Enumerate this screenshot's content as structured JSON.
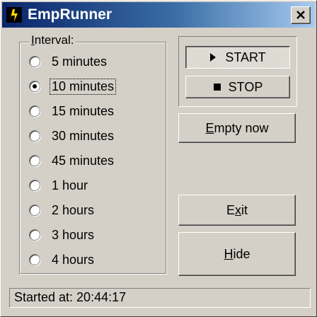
{
  "window": {
    "title": "EmpRunner"
  },
  "interval": {
    "legend": "Interval:",
    "options": [
      "5 minutes",
      "10 minutes",
      "15 minutes",
      "30 minutes",
      "45 minutes",
      "1 hour",
      "2 hours",
      "3 hours",
      "4 hours"
    ],
    "selected": "10 minutes"
  },
  "buttons": {
    "start": "START",
    "stop": "STOP",
    "empty_now": "Empty now",
    "exit": "Exit",
    "hide": "Hide"
  },
  "status": {
    "text": "Started at: 20:44:17"
  },
  "colors": {
    "titlebar_start": "#0a246a",
    "titlebar_end": "#a6caf0",
    "face": "#d4d0c8"
  }
}
